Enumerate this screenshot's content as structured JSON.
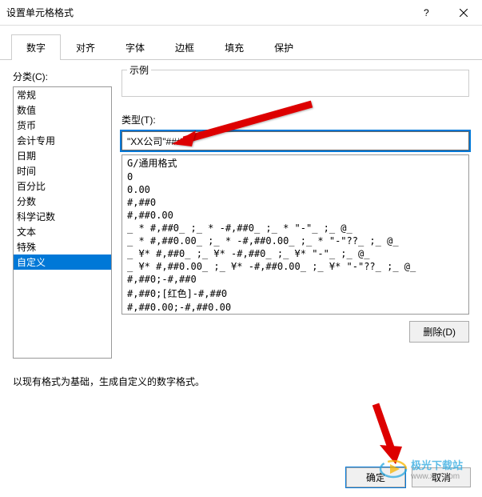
{
  "title": "设置单元格格式",
  "tabs": [
    "数字",
    "对齐",
    "字体",
    "边框",
    "填充",
    "保护"
  ],
  "active_tab": 0,
  "left_label": "分类(C):",
  "categories": [
    "常规",
    "数值",
    "货币",
    "会计专用",
    "日期",
    "时间",
    "百分比",
    "分数",
    "科学记数",
    "文本",
    "特殊",
    "自定义"
  ],
  "selected_category": 11,
  "sample_label": "示例",
  "type_label": "类型(T):",
  "type_value": "\"XX公司\"###",
  "type_items": [
    "G/通用格式",
    "0",
    "0.00",
    "#,##0",
    "#,##0.00",
    "_ * #,##0_ ;_ * -#,##0_ ;_ * \"-\"_ ;_ @_ ",
    "_ * #,##0.00_ ;_ * -#,##0.00_ ;_ * \"-\"??_ ;_ @_ ",
    "_ ¥* #,##0_ ;_ ¥* -#,##0_ ;_ ¥* \"-\"_ ;_ @_ ",
    "_ ¥* #,##0.00_ ;_ ¥* -#,##0.00_ ;_ ¥* \"-\"??_ ;_ @_ ",
    "#,##0;-#,##0",
    "#,##0;[红色]-#,##0",
    "#,##0.00;-#,##0.00"
  ],
  "delete_label": "删除(D)",
  "hint": "以现有格式为基础，生成自定义的数字格式。",
  "ok_label": "确定",
  "cancel_label": "取消",
  "watermark": {
    "brand": "极光下载站",
    "url": "www.xz7.com"
  }
}
